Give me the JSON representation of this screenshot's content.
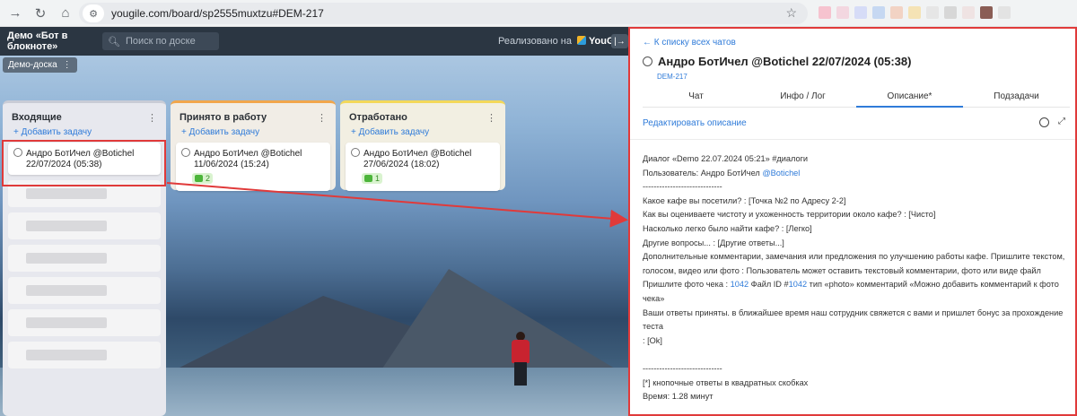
{
  "browser": {
    "url": "yougile.com/board/sp2555muxtzu#DEM-217",
    "extension_colors": [
      "#f6c3cf",
      "#f3d7e0",
      "#d6dcf7",
      "#c6d8f2",
      "#f2d3c4",
      "#f5e3b5",
      "#e6e6e6",
      "#d7d7d7",
      "#efe3e3",
      "#8a5d55",
      "#e3e3e3"
    ]
  },
  "board": {
    "project_name": "Демо «Бот в блокноте»",
    "search_placeholder": "Поиск по доске",
    "powered_by": "Реализовано на",
    "powered_brand": "YouGile",
    "board_tab": "Демо-доска",
    "columns": [
      {
        "title": "Входящие",
        "add_label": "+ Добавить задачу",
        "accent": "#c9ccd6",
        "cards": [
          {
            "title": "Андро БотИчел @Botichel",
            "date": "22/07/2024 (05:38)"
          }
        ]
      },
      {
        "title": "Принято в работу",
        "add_label": "+ Добавить задачу",
        "accent": "#f1a64b",
        "cards": [
          {
            "title": "Андро БотИчел @Botichel",
            "date": "11/06/2024 (15:24)",
            "badge": "2"
          }
        ]
      },
      {
        "title": "Отработано",
        "add_label": "+ Добавить задачу",
        "accent": "#f3d85a",
        "cards": [
          {
            "title": "Андро БотИчел @Botichel",
            "date": "27/06/2024 (18:02)",
            "badge": "1"
          }
        ]
      }
    ]
  },
  "panel": {
    "back_label": "← К списку всех чатов",
    "title": "Андро БотИчел @Botichel 22/07/2024 (05:38)",
    "task_id": "DEM-217",
    "tabs": [
      "Чат",
      "Инфо / Лог",
      "Описание*",
      "Подзадачи"
    ],
    "active_tab": 2,
    "edit_label": "Редактировать описание",
    "description": {
      "line1": "Диалог «Demo 22.07.2024 05:21» #диалоги",
      "user_prefix": "Пользователь: Андро БотИчел ",
      "user_handle": "@Botichel",
      "sep1": "-----------------------------",
      "q1": "Какое кафе вы посетили? : [Точка №2 по Адресу 2-2]",
      "q2": "Как вы оцениваете чистоту и ухоженность территории около кафе? : [Чисто]",
      "q3": "Насколько легко было найти кафе? : [Легко]",
      "q4": "Другие вопросы... : [Другие ответы...]",
      "q5a": "Дополнительные комментарии, замечания или предложения по улучшению работы кафе. Пришлите текстом,",
      "q5b": "голосом, видео или фото : Пользователь может оставить текстовый комментарии, фото или виде файл",
      "q6_prefix": "Пришлите фото чека : ",
      "q6_num": "1042",
      "q6_mid": " Файл ID #",
      "q6_id": "1042",
      "q6_rest": " тип «photo» комментарий «Можно добавить комментарий к фото чека»",
      "q7": "Ваши ответы приняты. в ближайшее время наш сотрудник свяжется с вами и пришлет бонус за прохождение теста",
      "q8": ": [Ok]",
      "sep2": "-----------------------------",
      "note": "[*] кнопочные ответы в квадратных скобках",
      "time": "Время: 1.28 минут"
    }
  }
}
